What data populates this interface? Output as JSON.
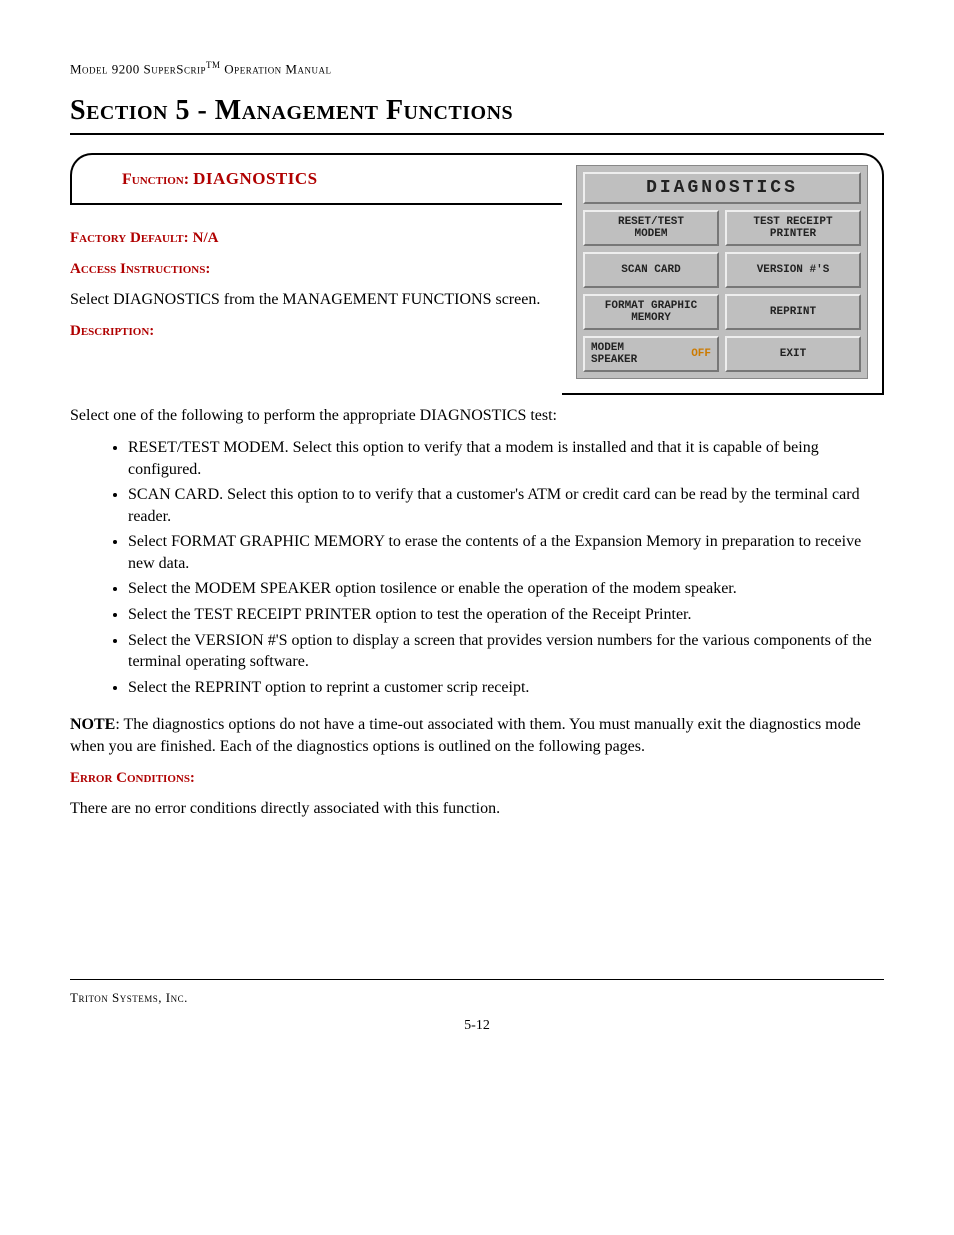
{
  "header": {
    "model_prefix": "Model 9200 S",
    "product_rest": "uperScrip",
    "tm": "TM",
    "suffix": " Operation Manual"
  },
  "section_title": "Section 5 - Management Functions",
  "function_banner": {
    "label": "Function:",
    "value": "DIAGNOSTICS"
  },
  "factory_default": {
    "label": "Factory Default:",
    "value": "N/A"
  },
  "access_instructions_label": "Access Instructions:",
  "access_instructions_body": "Select DIAGNOSTICS from the MANAGEMENT FUNCTIONS screen.",
  "description_label": "Description:",
  "description_lead": "Select one of the following to perform the appropriate DIAGNOSTICS test:",
  "bullets": [
    "RESET/TEST MODEM. Select this option to verify that a modem is installed and that it is capable of being configured.",
    "SCAN CARD. Select this option to to verify that a customer's ATM or credit card can be read by the terminal card reader.",
    "Select FORMAT GRAPHIC MEMORY to erase the contents of a the Expansion Memory in preparation to receive new data.",
    "Select the MODEM SPEAKER option tosilence or enable the operation of the modem speaker.",
    "Select the TEST RECEIPT PRINTER option to test the operation of the Receipt Printer.",
    "Select the VERSION #'S option to display a screen that provides version numbers for the various components of the terminal operating software.",
    "Select the REPRINT option to reprint a customer scrip receipt."
  ],
  "note_label": "NOTE",
  "note_body": ": The diagnostics options do not have a time-out associated with them.  You must manually exit the diagnostics mode when you are finished.  Each of the diagnostics options is outlined on the following pages.",
  "error_conditions_label": "Error Conditions:",
  "error_conditions_body": "There are no error conditions directly associated with this function.",
  "screen": {
    "title": "DIAGNOSTICS",
    "buttons": [
      {
        "label": "RESET/TEST\nMODEM"
      },
      {
        "label": "TEST RECEIPT\nPRINTER"
      },
      {
        "label": "SCAN CARD"
      },
      {
        "label": "VERSION #'S"
      },
      {
        "label": "FORMAT GRAPHIC\nMEMORY"
      },
      {
        "label": "REPRINT"
      },
      {
        "left": "MODEM\nSPEAKER",
        "right": "OFF"
      },
      {
        "label": "EXIT"
      }
    ]
  },
  "footer": "Triton Systems, Inc.",
  "page_number": "5-12"
}
